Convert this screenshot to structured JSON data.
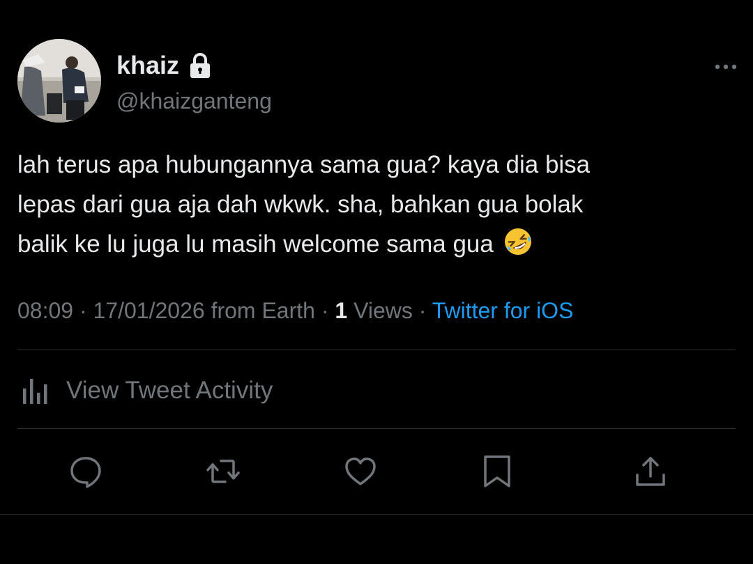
{
  "author": {
    "display_name": "khaiz",
    "handle": "@khaizganteng",
    "protected": true
  },
  "tweet": {
    "text_line_1": "lah terus apa hubungannya sama gua? kaya dia bisa",
    "text_line_2": "lepas dari gua aja dah wkwk. sha, bahkan gua bolak",
    "text_line_3": "balik ke lu juga lu masih welcome sama gua",
    "emoji": "🤣"
  },
  "meta": {
    "time": "08:09",
    "sep1": " · ",
    "date": "17/01/2026",
    "location": " from Earth",
    "sep2": " · ",
    "views_count": "1",
    "views_label": " Views",
    "sep3": " · ",
    "source": "Twitter for iOS"
  },
  "activity": {
    "label": "View Tweet Activity"
  },
  "icons": {
    "more": "more-horizontal-icon",
    "reply": "reply-icon",
    "retweet": "retweet-icon",
    "like": "heart-icon",
    "bookmark": "bookmark-icon",
    "share": "share-icon"
  },
  "colors": {
    "background": "#000000",
    "text_primary": "#e7e9ea",
    "text_secondary": "#71767b",
    "link": "#1d9bf0",
    "divider": "#2f3336"
  }
}
